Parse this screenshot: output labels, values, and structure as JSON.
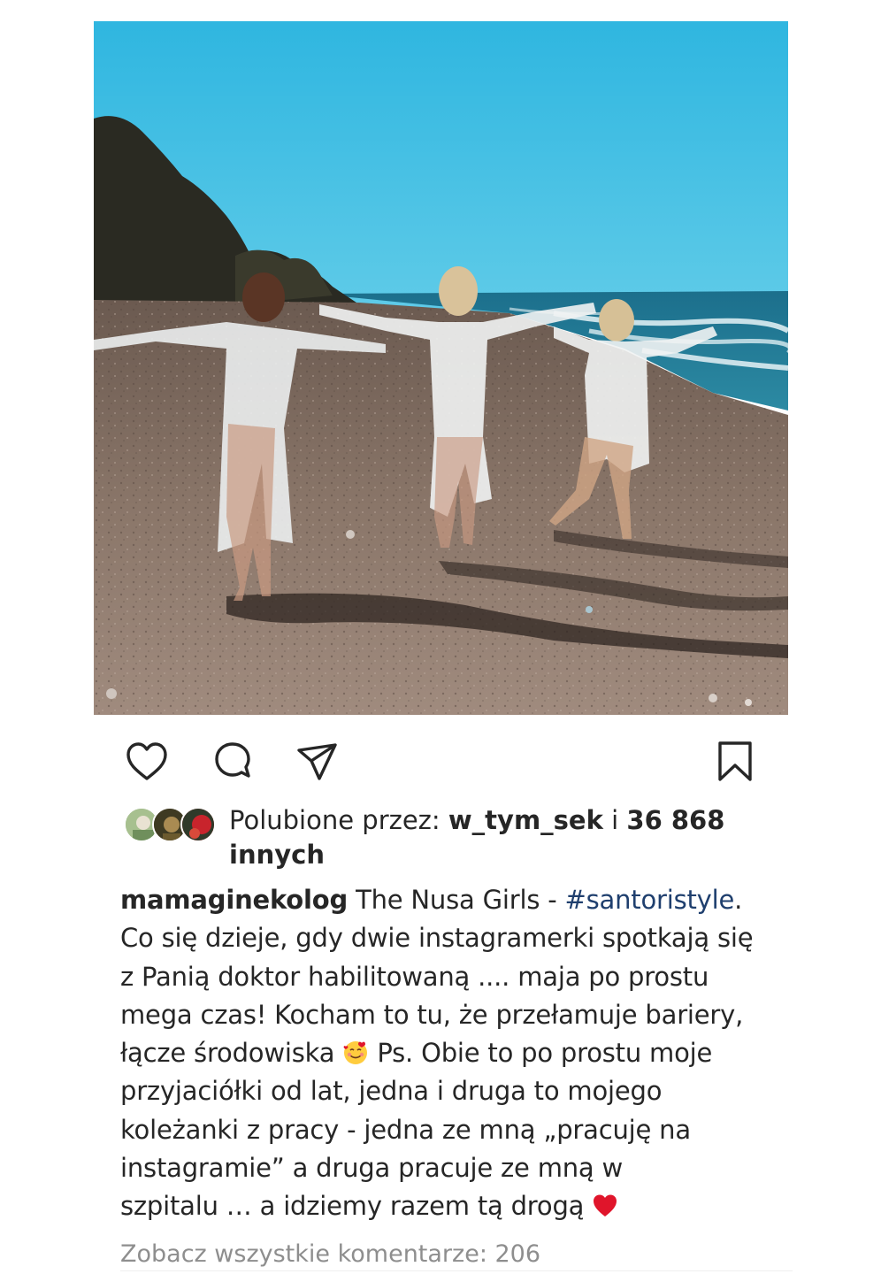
{
  "post": {
    "image_alt": "",
    "actions": {
      "like_icon": "heart-outline-icon",
      "comment_icon": "comment-bubble-icon",
      "share_icon": "paper-plane-icon",
      "save_icon": "bookmark-icon"
    },
    "likes": {
      "prefix": "Polubione przez:",
      "user": "w_tym_sek",
      "connector": "i",
      "count": "36 868",
      "suffix": "innych"
    },
    "caption": {
      "author": "mamaginekolog",
      "line1_text": "The Nusa Girls -",
      "hashtag": "#santoristyle",
      "line1_end": ".",
      "line2": "Co się dzieje, gdy dwie instagramerki spotkają się",
      "line3": "z Panią doktor habilitowaną .... maja po prostu",
      "line4": "mega czas! Kocham to tu, że przełamuje bariery,",
      "line5_start": "łącze środowiska",
      "line5_emoji": "smiling-face-with-hearts-emoji",
      "line5_end": "Ps. Obie to po prostu moje",
      "line6": "przyjaciółki od lat, jedna i druga to mojego",
      "line7": "koleżanki z pracy - jedna ze mną „pracuję na",
      "line8": "instagramie” a druga pracuje ze mną w",
      "line9": "szpitalu … a idziemy razem tą drogą",
      "line9_emoji": "red-heart-emoji"
    },
    "comments_link": "Zobacz wszystkie komentarze: 206",
    "colors": {
      "text": "#262626",
      "hashtag": "#1f3f6e",
      "muted": "#8e8e8e",
      "heart": "#e0152b"
    }
  }
}
